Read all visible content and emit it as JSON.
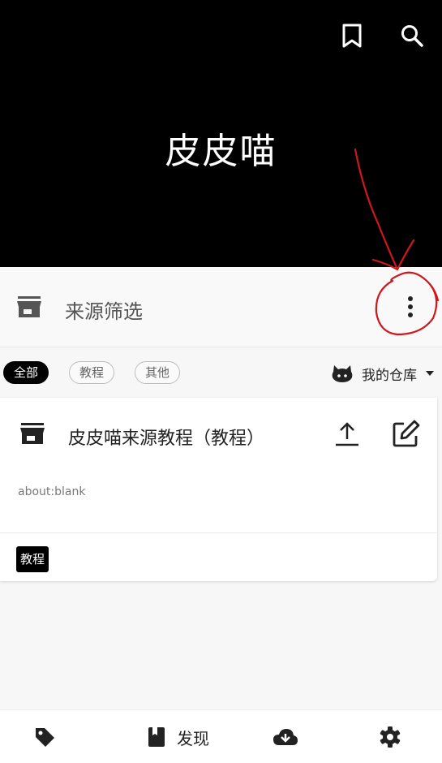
{
  "header": {
    "title": "皮皮喵",
    "icons": [
      "bookmark-icon",
      "search-icon"
    ]
  },
  "filter": {
    "label": "来源筛选",
    "icons": [
      "store-icon",
      "more-vert-icon"
    ]
  },
  "tags": {
    "chips": [
      {
        "label": "全部",
        "active": true
      },
      {
        "label": "教程",
        "active": false
      },
      {
        "label": "其他",
        "active": false
      }
    ],
    "repo_label": "我的仓库"
  },
  "card": {
    "title": "皮皮喵来源教程（教程）",
    "url": "about:blank",
    "tag": "教程",
    "icons": [
      "store-icon",
      "upload-icon",
      "edit-icon"
    ]
  },
  "nav": {
    "items": [
      {
        "icon": "tag-icon",
        "label": ""
      },
      {
        "icon": "book-icon",
        "label": "发现"
      },
      {
        "icon": "cloud-download-icon",
        "label": ""
      },
      {
        "icon": "gear-icon",
        "label": ""
      }
    ]
  },
  "colors": {
    "header_bg": "#000000",
    "annotation": "#d0171b",
    "chip_active_bg": "#000000"
  }
}
